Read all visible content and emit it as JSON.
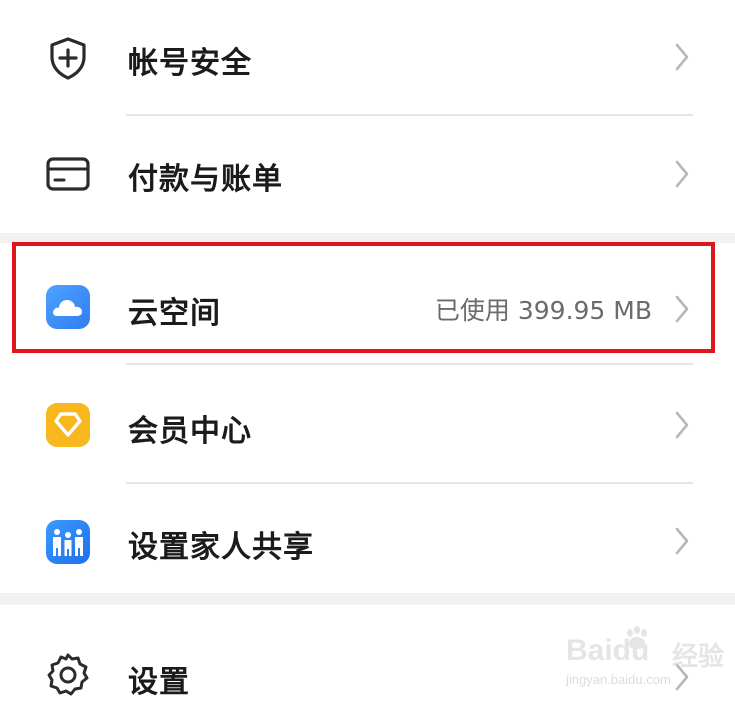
{
  "menu": {
    "account_security": {
      "label": "帐号安全",
      "icon": "shield-plus-icon"
    },
    "payment_billing": {
      "label": "付款与账单",
      "icon": "card-icon"
    },
    "cloud_space": {
      "label": "云空间",
      "value": "已使用 399.95 MB",
      "icon": "cloud-icon",
      "icon_color": "#3a8ef6"
    },
    "member_center": {
      "label": "会员中心",
      "icon": "diamond-badge-icon",
      "icon_color": "#f7b71d"
    },
    "family_sharing": {
      "label": "设置家人共享",
      "icon": "family-icon",
      "icon_color": "#2f80f0"
    },
    "settings": {
      "label": "设置",
      "icon": "gear-icon"
    }
  },
  "highlight": {
    "color": "#e0161e",
    "target": "cloud_space"
  },
  "watermark": {
    "brand": "Baidu",
    "brand_cn": "经验",
    "url": "jingyan.baidu.com"
  }
}
